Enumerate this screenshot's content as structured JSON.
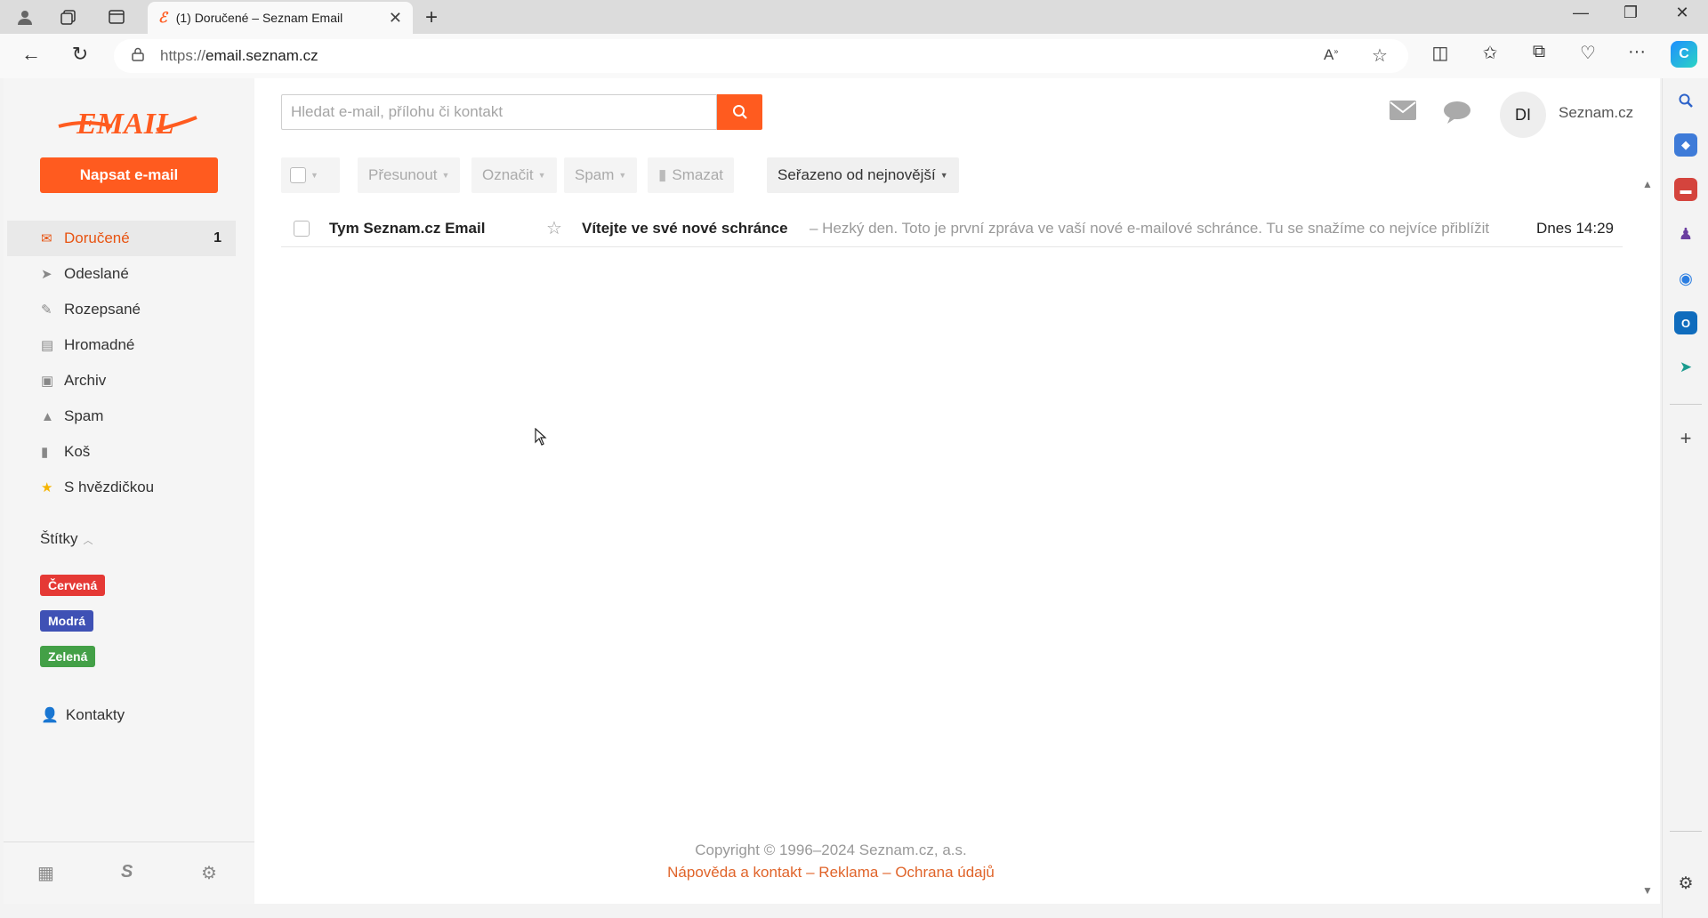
{
  "browser": {
    "tab_title": "(1) Doručené – Seznam Email",
    "url_dim": "https://",
    "url_main": "email.seznam.cz"
  },
  "app": {
    "compose_label": "Napsat e-mail",
    "search_placeholder": "Hledat e-mail, přílohu či kontakt",
    "avatar_initials": "DI",
    "account_name": "Seznam.cz"
  },
  "folders": [
    {
      "label": "Doručené",
      "icon": "inbox-icon",
      "count": "1"
    },
    {
      "label": "Odeslané",
      "icon": "send-icon"
    },
    {
      "label": "Rozepsané",
      "icon": "draft-icon"
    },
    {
      "label": "Hromadné",
      "icon": "cart-icon"
    },
    {
      "label": "Archiv",
      "icon": "archive-icon"
    },
    {
      "label": "Spam",
      "icon": "warning-icon"
    },
    {
      "label": "Koš",
      "icon": "trash-icon"
    },
    {
      "label": "S hvězdičkou",
      "icon": "star-icon"
    }
  ],
  "labels": {
    "heading": "Štítky",
    "items": [
      {
        "label": "Červená",
        "color": "#e53935"
      },
      {
        "label": "Modrá",
        "color": "#3f51b5"
      },
      {
        "label": "Zelená",
        "color": "#43a047"
      }
    ]
  },
  "contacts_label": "Kontakty",
  "toolbar": {
    "move": "Přesunout",
    "mark": "Označit",
    "spam": "Spam",
    "delete": "Smazat",
    "sort": "Seřazeno od nejnovější"
  },
  "messages": [
    {
      "sender": "Tym Seznam.cz Email",
      "subject": "Vítejte ve své nové schránce",
      "preview": "– Hezký den.  Toto je první zpráva ve vaší nové e-mailové schránce. Tu se snažíme co nejvíce přiblížit",
      "time": "Dnes 14:29"
    }
  ],
  "footer": {
    "copyright": "Copyright © 1996–2024 Seznam.cz, a.s.",
    "help": "Nápověda a kontakt",
    "ads": "Reklama",
    "privacy": "Ochrana údajů",
    "dash": "–"
  },
  "colors": {
    "brand": "#ff5b1f",
    "active_text": "#e85412"
  }
}
